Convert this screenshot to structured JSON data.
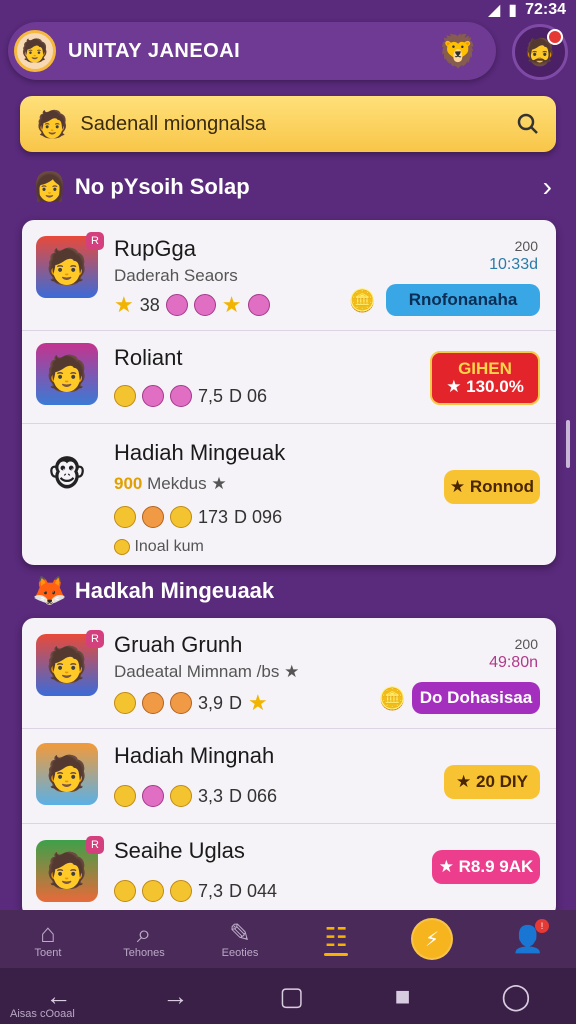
{
  "status": {
    "time": "72:34"
  },
  "header": {
    "title": "UNITAY JANEOAI"
  },
  "search": {
    "placeholder": "Sadenall miongnalsa"
  },
  "sections": [
    {
      "title": "No pYsoih Solap",
      "rows": [
        {
          "title": "RupGga",
          "subtitle": "Daderah Seaors",
          "rating": "38",
          "ts_top": "200",
          "ts_time": "10:33d",
          "action": "Rnofonanaha"
        },
        {
          "title": "Roliant",
          "rating": "7,5",
          "count": "D 06",
          "action_top": "GIHEN",
          "action": "★ 130.0%"
        },
        {
          "title": "Hadiah Mingeuak",
          "subtitle": "Mekdus ★",
          "sub_prefix": "900",
          "rating": "173",
          "count": "D 096",
          "extra": "Inoal kum",
          "action": "★ Ronnod"
        }
      ]
    },
    {
      "title": "Hadkah Mingeuaak",
      "rows": [
        {
          "title": "Gruah Grunh",
          "subtitle": "Dadeatal Mimnam /bs ★",
          "rating": "3,9",
          "count": "D",
          "ts_top": "200",
          "ts_time": "49:80n",
          "action": "Do Dohasisaa"
        },
        {
          "title": "Hadiah Mingnah",
          "rating": "3,3",
          "count": "D 066",
          "action": "★ 20 DIY"
        },
        {
          "title": "Seaihe Uglas",
          "rating": "7,3",
          "count": "D 044",
          "action": "★ R8.9 9AK"
        }
      ]
    }
  ],
  "nav": [
    {
      "label": "Toent"
    },
    {
      "label": "Tehones"
    },
    {
      "label": "Eeoties"
    },
    {
      "label": ""
    },
    {
      "label": ""
    },
    {
      "label": ""
    }
  ],
  "sys_label": "Aisas cOoaal",
  "colors": {
    "primary": "#5a2a7c",
    "accent": "#f8c648",
    "blue": "#39a7e6",
    "red": "#e3242b"
  }
}
